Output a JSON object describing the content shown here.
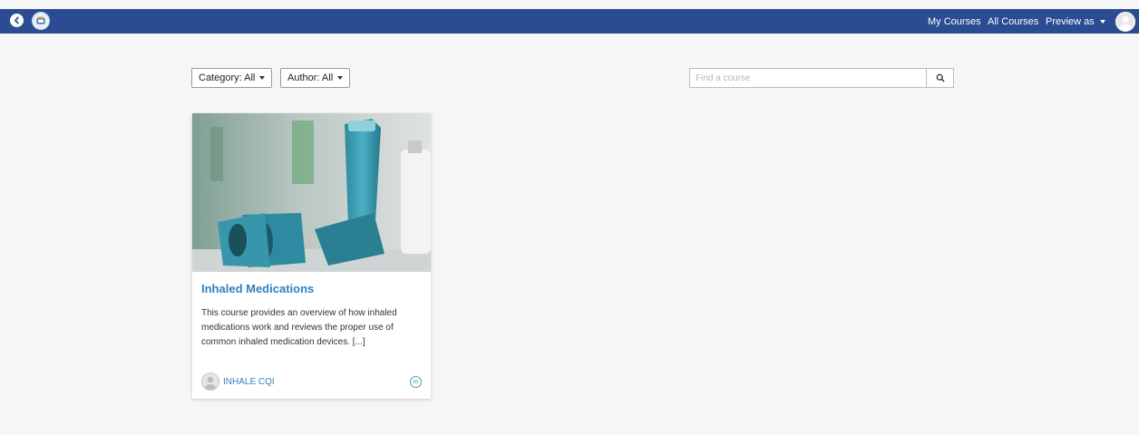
{
  "topbar": {
    "back_icon": "chevron-left-circle-icon",
    "logo_icon": "site-logo-icon",
    "nav": {
      "my_courses": "My Courses",
      "all_courses": "All Courses",
      "preview_as": "Preview as"
    },
    "user_avatar_icon": "user-avatar-icon",
    "color": "#2b4b93"
  },
  "filters": {
    "category": "Category: All",
    "author": "Author: All"
  },
  "search": {
    "placeholder": "Find a course",
    "value": "",
    "icon": "search-icon"
  },
  "courses": [
    {
      "title": "Inhaled Medications",
      "description": "This course provides an overview of how inhaled medications work and reviews the proper use of common inhaled medication devices. [...]",
      "author": "INHALE CQI",
      "badge": "80",
      "image": "inhaler-photo"
    }
  ],
  "accent": "#2e7fbf"
}
